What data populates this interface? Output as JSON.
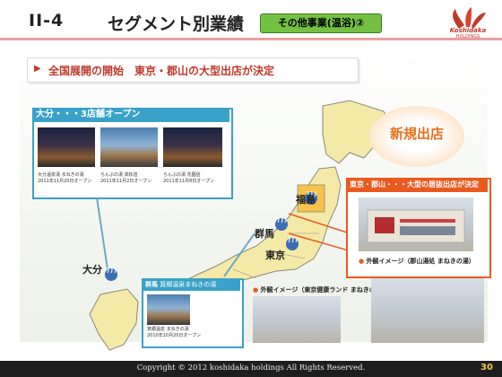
{
  "header": {
    "section_number": "II-4",
    "title": "セグメント別業績",
    "badge": "その他事業(温浴)②",
    "logo_word": "Koshidaka",
    "logo_sub": "HOLDINGS",
    "accent_color": "#e8a0a0"
  },
  "banner": {
    "text": "全国展開の開始　東京・郡山の大型出店が決定",
    "text_color": "#c0392b"
  },
  "oita_callout": {
    "title": "大分・・・3店舗オープン",
    "photos": [
      {
        "caption_line1": "大分温泉湯 まねきの湯",
        "caption_line2": "2011年11月20日オープン"
      },
      {
        "caption_line1": "らんぷの湯 高松店",
        "caption_line2": "2011年11月2日オープン"
      },
      {
        "caption_line1": "らんぷの湯 花園店",
        "caption_line2": "2011年11月8日オープン"
      }
    ]
  },
  "new_store_label": "新規出店",
  "tokyo_callout": {
    "title": "東京・郡山・・・大型の居抜出店が決定",
    "caption": "外観イメージ（郡山湯処 まねきの湯）"
  },
  "gunma_callout": {
    "title_prefix": "群馬",
    "title": "箕郷温泉まねきの湯",
    "caption_line1": "箕郷温泉 まねきの湯",
    "caption_line2": "2010年10月20日オープン"
  },
  "tokyo_image_caption": "外観イメージ（東京健康ランド まねきの湯）",
  "map": {
    "labels": {
      "oita": "大分",
      "gunma": "群馬",
      "tokyo": "東京",
      "fukushima": "福島"
    },
    "land_color": "#f5e9a8",
    "outline_color": "#8a8a7a",
    "onsen_icon_color": "#3a6fb5"
  },
  "footer": {
    "copyright": "Copyright © 2012 koshidaka holdings All Rights Reserved.",
    "page_number": "30"
  }
}
